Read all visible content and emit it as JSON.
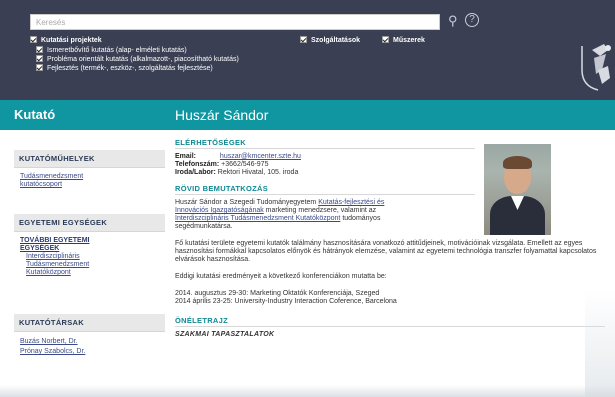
{
  "header": {
    "search_placeholder": "Keresés",
    "filters_row1": [
      {
        "label": "Kutatási projektek"
      },
      {
        "label": "Szolgáltatások"
      },
      {
        "label": "Műszerek"
      }
    ],
    "filters_sub": [
      {
        "label": "Ismeretbővítő kutatás (alap- elméleti kutatás)"
      },
      {
        "label": "Probléma orientált kutatás (alkalmazott-, piacosítható kutatás)"
      },
      {
        "label": "Fejlesztés (termék-, eszköz-, szolgáltatás fejlesztése)"
      }
    ]
  },
  "band": {
    "left_title": "Kutató",
    "person_name": "Huszár Sándor"
  },
  "sidebar": {
    "sections": [
      {
        "heading": "KUTATÓMŰHELYEK",
        "links": [
          "Tudásmenedzsment",
          "kutatócsoport"
        ]
      },
      {
        "heading": "EGYETEMI EGYSÉGEK",
        "bold_links": [
          "TOVÁBBI EGYETEMI",
          "EGYSÉGEK"
        ],
        "links": [
          "Interdiszciplináris",
          "Tudásmenedzsment",
          "Kutatóközpont"
        ]
      },
      {
        "heading": "KUTATÓTÁRSAK",
        "links": [
          "Buzás Norbert, Dr.",
          "Prónay Szabolcs, Dr."
        ]
      }
    ]
  },
  "main": {
    "contact_title": "ELÉRHETŐSÉGEK",
    "email_label": "Email:",
    "email_value": "huszar@kmcenter.szte.hu",
    "phone_label": "Telefonszám:",
    "phone_value": "+3662/546-975",
    "office_label": "Iroda/Labor:",
    "office_value": "Rektori Hivatal, 105. iroda",
    "intro_title": "RÖVID BEMUTATKOZÁS",
    "intro_p1_a": "Huszár Sándor a Szegedi Tudományegyetem ",
    "intro_p1_link1a": "Kutatás-fejlesztési és",
    "intro_p1_link1b": "Innovációs Igazgatóságának",
    "intro_p1_b": " marketing menedzsere, valamint az",
    "intro_p1_link2": "Interdiszciplináris Tudásmenedzsment Kutatóközpont",
    "intro_p1_c": " tudományos",
    "intro_p1_d": "segédmunkatársa.",
    "intro_p2": "Fő kutatási területe egyetemi kutatók találmány hasznosítására vonatkozó attitűdjeinek, motivációinak vizsgálata. Emellett az egyes hasznosítási formákkal kapcsolatos előnyök és hátrányok elemzése, valamint az egyetemi technológia transzfer folyamattal kapcsolatos elvárások hasznosítása.",
    "intro_p3": "Eddigi kutatási eredményeit a következő konferenciákon mutatta be:",
    "conf1": "2014. augusztus 29-30: Marketing Oktatók Konferenciája, Szeged",
    "conf2": "2014 április 23-25: University-Industry Interaction Coference, Barcelona",
    "cv_title": "ÖNÉLETRAJZ",
    "cv_sub": "SZAKMAI TAPASZTALATOK"
  }
}
